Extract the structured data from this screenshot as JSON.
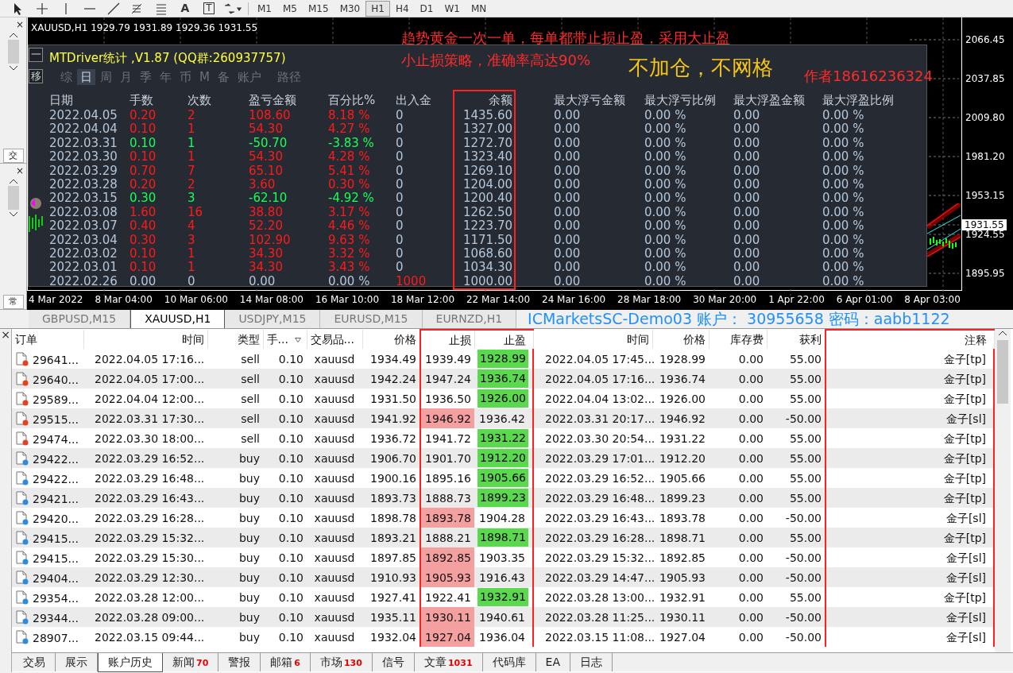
{
  "toolbar": {
    "tools": [
      {
        "kind": "cursor"
      },
      {
        "kind": "crosshair"
      },
      {
        "kind": "vline"
      },
      {
        "kind": "hline"
      },
      {
        "kind": "trendline"
      },
      {
        "kind": "fibo-e"
      },
      {
        "kind": "fibo-f"
      },
      {
        "kind": "glyph",
        "glyph": "A"
      },
      {
        "kind": "boxed-glyph",
        "glyph": "T"
      },
      {
        "kind": "arrows"
      }
    ],
    "timeframes": [
      {
        "label": "M1",
        "selected": false
      },
      {
        "label": "M5",
        "selected": false
      },
      {
        "label": "M15",
        "selected": false
      },
      {
        "label": "M30",
        "selected": false
      },
      {
        "label": "H1",
        "selected": true
      },
      {
        "label": "H4",
        "selected": false
      },
      {
        "label": "D1",
        "selected": false
      },
      {
        "label": "W1",
        "selected": false
      },
      {
        "label": "MN",
        "selected": false
      }
    ]
  },
  "side_panels": [
    {
      "close": "×",
      "tab": "交"
    },
    {
      "close": "×",
      "tab": "常"
    }
  ],
  "chart": {
    "symbol_info": "XAUUSD,H1  1929.79 1931.89 1929.36 1931.55",
    "price_axis": [
      {
        "label": "2066.45",
        "current": false
      },
      {
        "label": "2037.85",
        "current": false
      },
      {
        "label": "2009.80",
        "current": false
      },
      {
        "label": "1981.20",
        "current": false
      },
      {
        "label": "1953.15",
        "current": false
      },
      {
        "label": "1931.55",
        "current": true
      },
      {
        "label": "1924.55",
        "current": false
      },
      {
        "label": "1895.95",
        "current": false
      }
    ],
    "time_axis": [
      "4 Mar 2022",
      "8 Mar 04:00",
      "10 Mar 06:00",
      "14 Mar 08:00",
      "16 Mar 10:00",
      "18 Mar 12:00",
      "22 Mar 14:00",
      "24 Mar 16:00",
      "28 Mar 18:00",
      "30 Mar 20:00",
      "1 Apr 22:00",
      "6 Apr 01:00",
      "8 Apr 03:00"
    ],
    "notes": [
      {
        "kind": "red",
        "text": "趋势黄金一次一单，每单都带止损止盈，采用大止盈"
      },
      {
        "kind": "red",
        "text": "小止损策略，准确率高达90%"
      },
      {
        "kind": "big-yellow",
        "text": "不加仓，不网格"
      },
      {
        "kind": "red-right",
        "text": "作者18616236324"
      }
    ]
  },
  "stats": {
    "minimize": "一",
    "move": "移",
    "title": "MTDriver统计 ,V1.87 (QQ群:260937757)",
    "periods": [
      {
        "label": "综",
        "selected": false
      },
      {
        "label": "日",
        "selected": true
      },
      {
        "label": "周",
        "selected": false
      },
      {
        "label": "月",
        "selected": false
      },
      {
        "label": "季",
        "selected": false
      },
      {
        "label": "年",
        "selected": false
      },
      {
        "label": "币",
        "selected": false
      },
      {
        "label": "M",
        "selected": false
      },
      {
        "label": "备",
        "selected": false
      },
      {
        "label": "账户",
        "selected": false
      },
      {
        "label": "路径",
        "selected": false
      }
    ],
    "columns": [
      {
        "label": "日期",
        "highlighted": false
      },
      {
        "label": "手数",
        "highlighted": false
      },
      {
        "label": "次数",
        "highlighted": false
      },
      {
        "label": "盈亏金额",
        "highlighted": false
      },
      {
        "label": "百分比%",
        "highlighted": false
      },
      {
        "label": "出入金",
        "highlighted": false
      },
      {
        "label": "余额",
        "highlighted": true
      },
      {
        "label": "最大浮亏金额",
        "highlighted": false
      },
      {
        "label": "最大浮亏比例",
        "highlighted": false
      },
      {
        "label": "最大浮盈金额",
        "highlighted": false
      },
      {
        "label": "最大浮盈比例",
        "highlighted": false
      }
    ],
    "rows": [
      {
        "kind": "gain",
        "cells": [
          "2022.04.05",
          "0.20",
          "2",
          "108.60",
          "8.18 %",
          "0",
          "1435.60",
          "0.00",
          "0.00 %",
          "0.00",
          "0.00 %"
        ]
      },
      {
        "kind": "gain",
        "cells": [
          "2022.04.04",
          "0.10",
          "1",
          "54.30",
          "4.27 %",
          "0",
          "1327.00",
          "0.00",
          "0.00 %",
          "0.00",
          "0.00 %"
        ]
      },
      {
        "kind": "loss",
        "cells": [
          "2022.03.31",
          "0.10",
          "1",
          "-50.70",
          "-3.83 %",
          "0",
          "1272.70",
          "0.00",
          "0.00 %",
          "0.00",
          "0.00 %"
        ]
      },
      {
        "kind": "gain",
        "cells": [
          "2022.03.30",
          "0.10",
          "1",
          "54.30",
          "4.28 %",
          "0",
          "1323.40",
          "0.00",
          "0.00 %",
          "0.00",
          "0.00 %"
        ]
      },
      {
        "kind": "gain",
        "cells": [
          "2022.03.29",
          "0.70",
          "7",
          "65.10",
          "5.41 %",
          "0",
          "1269.10",
          "0.00",
          "0.00 %",
          "0.00",
          "0.00 %"
        ]
      },
      {
        "kind": "gain",
        "cells": [
          "2022.03.28",
          "0.20",
          "2",
          "3.60",
          "0.30 %",
          "0",
          "1204.00",
          "0.00",
          "0.00 %",
          "0.00",
          "0.00 %"
        ]
      },
      {
        "kind": "loss",
        "cells": [
          "2022.03.15",
          "0.30",
          "3",
          "-62.10",
          "-4.92 %",
          "0",
          "1200.40",
          "0.00",
          "0.00 %",
          "0.00",
          "0.00 %"
        ]
      },
      {
        "kind": "gain",
        "cells": [
          "2022.03.08",
          "1.60",
          "16",
          "38.80",
          "3.17 %",
          "0",
          "1262.50",
          "0.00",
          "0.00 %",
          "0.00",
          "0.00 %"
        ]
      },
      {
        "kind": "gain",
        "cells": [
          "2022.03.07",
          "0.40",
          "4",
          "52.20",
          "4.46 %",
          "0",
          "1223.70",
          "0.00",
          "0.00 %",
          "0.00",
          "0.00 %"
        ]
      },
      {
        "kind": "gain",
        "cells": [
          "2022.03.04",
          "0.30",
          "3",
          "102.90",
          "9.63 %",
          "0",
          "1171.50",
          "0.00",
          "0.00 %",
          "0.00",
          "0.00 %"
        ]
      },
      {
        "kind": "gain",
        "cells": [
          "2022.03.02",
          "0.10",
          "1",
          "34.30",
          "3.32 %",
          "0",
          "1068.60",
          "0.00",
          "0.00 %",
          "0.00",
          "0.00 %"
        ]
      },
      {
        "kind": "gain",
        "cells": [
          "2022.03.01",
          "0.10",
          "1",
          "34.30",
          "3.43 %",
          "0",
          "1034.30",
          "0.00",
          "0.00 %",
          "0.00",
          "0.00 %"
        ]
      },
      {
        "kind": "deposit",
        "cells": [
          "2022.02.26",
          "0.00",
          "0",
          "0.00",
          "0.00 %",
          "1000",
          "1000.00",
          "0.00",
          "0.00 %",
          "0.00",
          "0.00 %"
        ]
      }
    ]
  },
  "chart_tabs": [
    {
      "label": "GBPUSD,M15",
      "selected": false
    },
    {
      "label": "XAUUSD,H1",
      "selected": true
    },
    {
      "label": "USDJPY,M15",
      "selected": false
    },
    {
      "label": "EURUSD,M15",
      "selected": false
    },
    {
      "label": "EURNZD,H1",
      "selected": false
    }
  ],
  "account_banner": "ICMarketsSC-Demo03  账户：  30955658  密码：aabb1122",
  "terminal": {
    "close": "×",
    "columns": [
      {
        "label": "订单",
        "highlighted": false
      },
      {
        "label": "时间",
        "highlighted": false
      },
      {
        "label": "类型",
        "highlighted": false
      },
      {
        "label": "手...",
        "highlighted": false
      },
      {
        "label": "交易品...",
        "highlighted": false
      },
      {
        "label": "价格",
        "highlighted": false
      },
      {
        "label": "止损",
        "highlighted": true
      },
      {
        "label": "止盈",
        "highlighted": true
      },
      {
        "label": "时间",
        "highlighted": false
      },
      {
        "label": "价格",
        "highlighted": false
      },
      {
        "label": "库存费",
        "highlighted": false
      },
      {
        "label": "获利",
        "highlighted": false
      },
      {
        "label": "注释",
        "highlighted": true
      }
    ],
    "rows": [
      {
        "color": "#e8401c",
        "kind": "take-profit",
        "cells": [
          "29641...",
          "2022.04.05 17:16...",
          "sell",
          "0.10",
          "xauusd",
          "1934.49",
          "1939.49",
          "1928.99",
          "2022.04.05 17:45...",
          "1928.99",
          "0.00",
          "55.00",
          "金子[tp]"
        ]
      },
      {
        "color": "#e8401c",
        "kind": "take-profit",
        "cells": [
          "29640...",
          "2022.04.05 17:00...",
          "sell",
          "0.10",
          "xauusd",
          "1942.24",
          "1947.24",
          "1936.74",
          "2022.04.05 17:16...",
          "1936.74",
          "0.00",
          "55.00",
          "金子[tp]"
        ]
      },
      {
        "color": "#e8401c",
        "kind": "take-profit",
        "cells": [
          "29589...",
          "2022.04.04 12:00...",
          "sell",
          "0.10",
          "xauusd",
          "1931.50",
          "1936.50",
          "1926.00",
          "2022.04.04 13:02...",
          "1926.00",
          "0.00",
          "55.00",
          "金子[tp]"
        ]
      },
      {
        "color": "#e8401c",
        "kind": "stop-loss",
        "cells": [
          "29515...",
          "2022.03.31 17:30...",
          "sell",
          "0.10",
          "xauusd",
          "1941.92",
          "1946.92",
          "1936.42",
          "2022.03.31 20:17...",
          "1946.92",
          "0.00",
          "-50.00",
          "金子[sl]"
        ]
      },
      {
        "color": "#e8401c",
        "kind": "take-profit",
        "cells": [
          "29474...",
          "2022.03.30 18:00...",
          "sell",
          "0.10",
          "xauusd",
          "1936.72",
          "1941.72",
          "1931.22",
          "2022.03.30 20:54...",
          "1931.22",
          "0.00",
          "55.00",
          "金子[tp]"
        ]
      },
      {
        "color": "#2a8be0",
        "kind": "take-profit",
        "cells": [
          "29422...",
          "2022.03.29 16:52...",
          "buy",
          "0.10",
          "xauusd",
          "1906.70",
          "1901.70",
          "1912.20",
          "2022.03.29 17:01...",
          "1912.20",
          "0.00",
          "55.00",
          "金子[tp]"
        ]
      },
      {
        "color": "#2a8be0",
        "kind": "take-profit",
        "cells": [
          "29422...",
          "2022.03.29 16:48...",
          "buy",
          "0.10",
          "xauusd",
          "1900.16",
          "1895.16",
          "1905.66",
          "2022.03.29 16:52...",
          "1905.66",
          "0.00",
          "55.00",
          "金子[tp]"
        ]
      },
      {
        "color": "#2a8be0",
        "kind": "take-profit",
        "cells": [
          "29421...",
          "2022.03.29 16:43...",
          "buy",
          "0.10",
          "xauusd",
          "1893.73",
          "1888.73",
          "1899.23",
          "2022.03.29 16:48...",
          "1899.23",
          "0.00",
          "55.00",
          "金子[tp]"
        ]
      },
      {
        "color": "#2a8be0",
        "kind": "stop-loss",
        "cells": [
          "29420...",
          "2022.03.29 16:28...",
          "buy",
          "0.10",
          "xauusd",
          "1898.78",
          "1893.78",
          "1904.28",
          "2022.03.29 16:43...",
          "1893.78",
          "0.00",
          "-50.00",
          "金子[sl]"
        ]
      },
      {
        "color": "#2a8be0",
        "kind": "take-profit",
        "cells": [
          "29415...",
          "2022.03.29 15:32...",
          "buy",
          "0.10",
          "xauusd",
          "1893.21",
          "1888.21",
          "1898.71",
          "2022.03.29 16:28...",
          "1898.71",
          "0.00",
          "55.00",
          "金子[tp]"
        ]
      },
      {
        "color": "#2a8be0",
        "kind": "stop-loss",
        "cells": [
          "29415...",
          "2022.03.29 15:30...",
          "buy",
          "0.10",
          "xauusd",
          "1897.85",
          "1892.85",
          "1903.35",
          "2022.03.29 15:32...",
          "1892.85",
          "0.00",
          "-50.00",
          "金子[sl]"
        ]
      },
      {
        "color": "#2a8be0",
        "kind": "stop-loss",
        "cells": [
          "29404...",
          "2022.03.29 12:30...",
          "buy",
          "0.10",
          "xauusd",
          "1910.93",
          "1905.93",
          "1916.43",
          "2022.03.29 14:47...",
          "1905.93",
          "0.00",
          "-50.00",
          "金子[sl]"
        ]
      },
      {
        "color": "#2a8be0",
        "kind": "take-profit",
        "cells": [
          "29354...",
          "2022.03.28 12:00...",
          "buy",
          "0.10",
          "xauusd",
          "1927.41",
          "1922.41",
          "1932.91",
          "2022.03.28 13:00...",
          "1932.91",
          "0.00",
          "55.00",
          "金子[tp]"
        ]
      },
      {
        "color": "#2a8be0",
        "kind": "stop-loss",
        "cells": [
          "29344...",
          "2022.03.28 09:00...",
          "buy",
          "0.10",
          "xauusd",
          "1935.11",
          "1930.11",
          "1940.61",
          "2022.03.28 11:25...",
          "1930.11",
          "0.00",
          "-50.00",
          "金子[sl]"
        ]
      },
      {
        "color": "#2a8be0",
        "kind": "stop-loss",
        "cells": [
          "28907...",
          "2022.03.15 09:44...",
          "buy",
          "0.10",
          "xauusd",
          "1932.04",
          "1927.04",
          "1936.04",
          "2022.03.15 11:08...",
          "1927.04",
          "0.00",
          "-50.00",
          "金子[sl]"
        ]
      }
    ],
    "tabs": [
      {
        "label": "交易",
        "selected": false
      },
      {
        "label": "展示",
        "selected": false
      },
      {
        "label": "账户历史",
        "selected": true
      },
      {
        "label": "新闻",
        "count": "70",
        "selected": false
      },
      {
        "label": "警报",
        "selected": false
      },
      {
        "label": "邮箱",
        "count": "6",
        "selected": false
      },
      {
        "label": "市场",
        "count": "130",
        "selected": false
      },
      {
        "label": "信号",
        "selected": false
      },
      {
        "label": "文章",
        "count": "1031",
        "selected": false
      },
      {
        "label": "代码库",
        "selected": false
      },
      {
        "label": "EA",
        "selected": false
      },
      {
        "label": "日志",
        "selected": false
      }
    ]
  }
}
